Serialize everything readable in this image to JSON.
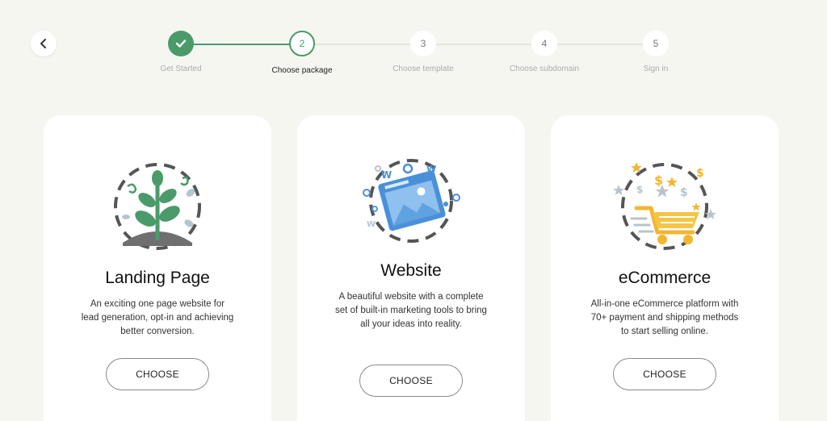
{
  "steps": [
    {
      "num": "",
      "label": "Get Started",
      "state": "done"
    },
    {
      "num": "2",
      "label": "Choose package",
      "state": "active"
    },
    {
      "num": "3",
      "label": "Choose template",
      "state": "pending"
    },
    {
      "num": "4",
      "label": "Choose subdomain",
      "state": "pending"
    },
    {
      "num": "5",
      "label": "Sign in",
      "state": "pending"
    }
  ],
  "cards": [
    {
      "title": "Landing Page",
      "description": "An exciting one page website for lead generation, opt-in and achieving better conversion.",
      "button": "CHOOSE",
      "icon": "plant-icon"
    },
    {
      "title": "Website",
      "description": "A beautiful website with a complete set of built-in marketing tools to bring all your ideas into reality.",
      "button": "CHOOSE",
      "icon": "browser-window-icon"
    },
    {
      "title": "eCommerce",
      "description": "All-in-one eCommerce platform with 70+ payment and shipping methods to start selling online.",
      "button": "CHOOSE",
      "icon": "shopping-cart-icon"
    }
  ],
  "colors": {
    "accent": "#4a9a6a",
    "background": "#f6f6f1"
  }
}
